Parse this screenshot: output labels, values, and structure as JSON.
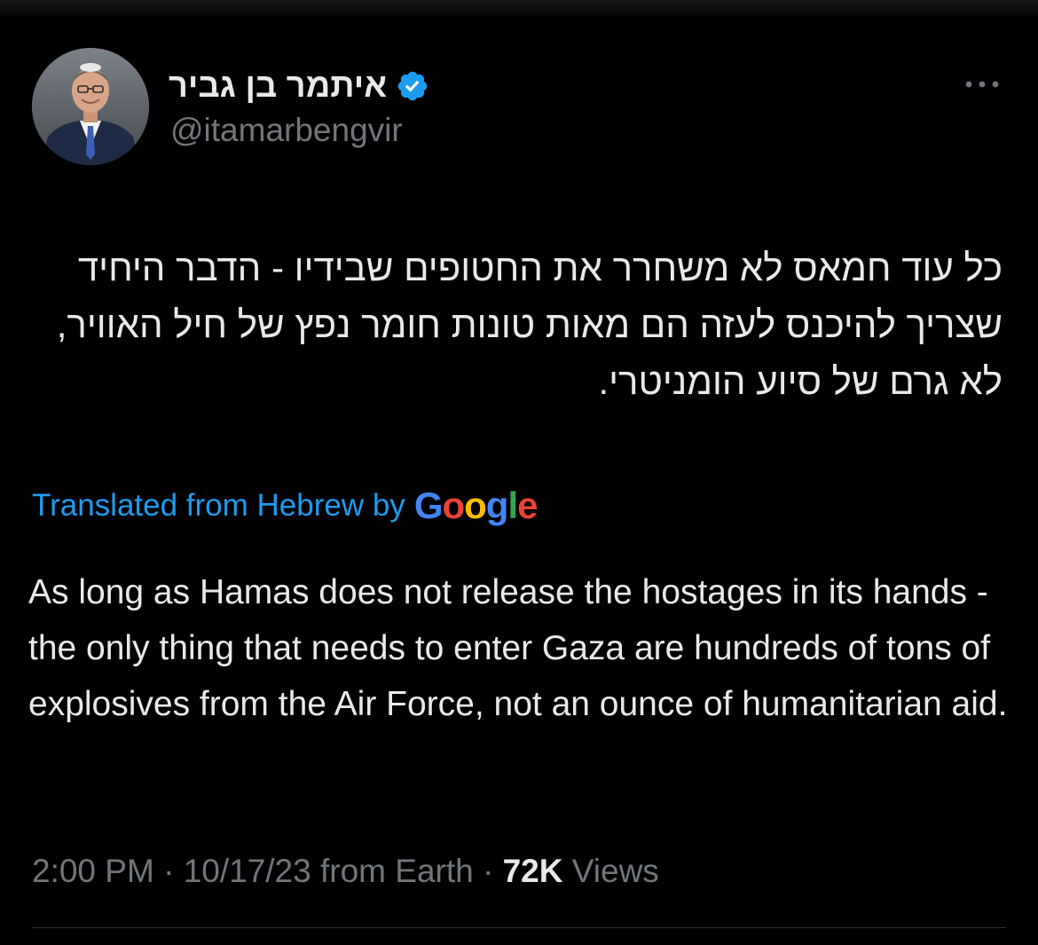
{
  "author": {
    "display_name": "איתמר בן גביר",
    "handle": "@itamarbengvir",
    "verified_color": "#1d9bf0"
  },
  "tweet": {
    "hebrew_text": "כל עוד חמאס לא משחרר את החטופים שבידיו -  הדבר היחיד שצריך להיכנס לעזה הם מאות טונות חומר נפץ של חיל האוויר, לא גרם של סיוע הומניטרי.",
    "translation_label": "Translated from Hebrew by",
    "translation_provider": "Google",
    "english_text": "As long as Hamas does not release the hostages in its hands - the only thing that needs to enter Gaza are hundreds of tons of explosives from the Air Force, not an ounce of humanitarian aid."
  },
  "meta": {
    "time": "2:00 PM",
    "separator": " · ",
    "date": "10/17/23",
    "source": "from Earth",
    "views_count": "72K",
    "views_label": "Views"
  },
  "icons": {
    "more": "more-horizontal-icon",
    "verified": "verified-badge-icon"
  },
  "colors": {
    "background": "#000000",
    "text_primary": "#e7e9ea",
    "text_secondary": "#71767b",
    "link": "#1d9bf0",
    "divider": "#2f3336"
  }
}
